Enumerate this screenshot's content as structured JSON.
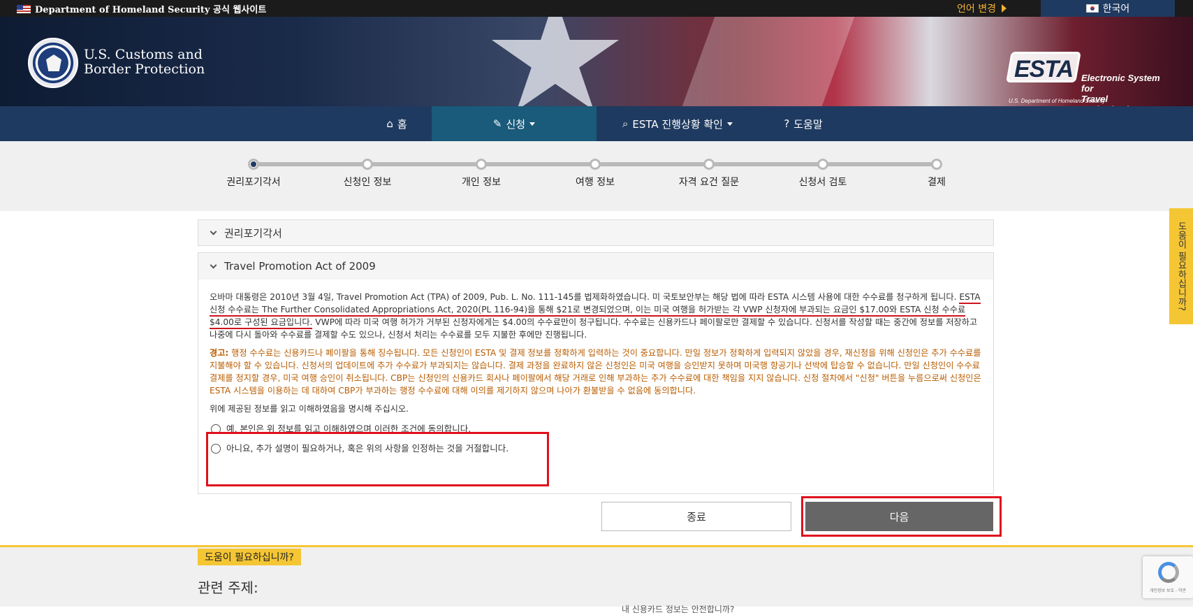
{
  "topbar": {
    "gov_text": "Department of Homeland Security 공식 웹사이트",
    "language_change": "언어 변경",
    "current_language": "한국어"
  },
  "header": {
    "agency_line1": "U.S. Customs and",
    "agency_line2": "Border Protection",
    "esta_word": "ESTA",
    "esta_tag1": "Electronic System for",
    "esta_tag2": "Travel Authorization",
    "esta_sub": "U.S. Department of Homeland Security"
  },
  "nav": {
    "home": "홈",
    "apply": "신청",
    "status": "ESTA 진행상황 확인",
    "help": "도움말"
  },
  "progress": {
    "steps": [
      "권리포기각서",
      "신청인 정보",
      "개인 정보",
      "여행 정보",
      "자격 요건 질문",
      "신청서 검토",
      "결제"
    ],
    "current_index": 0
  },
  "panels": {
    "waiver_title": "권리포기각서",
    "tpa_title": "Travel Promotion Act of 2009",
    "para1_a": "오바마 대통령은 2010년 3월 4일, Travel Promotion Act (TPA) of 2009, Pub. L. No. 111-145를 법제화하였습니다. 미 국토보안부는 해당 법에 따라 ESTA 시스템 사용에 대한 수수료를 청구하게 됩니다. ",
    "para1_underlined": "ESTA 신청 수수료는 The Further Consolidated Appropriations Act, 2020(PL 116-94)을 통해 $21로 변경되었으며, 이는 미국 여행을 허가받는 각 VWP 신청자에 부과되는 요금인 $17.00와 ESTA 신청 수수료 $4.00로 구성된 요금입니다.",
    "para1_b": " VWP에 따라 미국 여행 허가가 거부된 신청자에게는 $4.00의 수수료만이 청구됩니다. 수수료는 신용카드나 페이팔로만 결제할 수 있습니다. 신청서를 작성할 때는 중간에 정보를 저장하고 나중에 다시 돌아와 수수료를 결제할 수도 있으나, 신청서 처리는 수수료를 모두 지불한 후에만 진행됩니다.",
    "warning_label": "경고:",
    "warning_text": " 행정 수수료는 신용카드나 페이팔을 통해 징수됩니다. 모든 신청인이 ESTA 및 결제 정보를 정확하게 입력하는 것이 중요합니다. 만일 정보가 정확하게 입력되지 않았을 경우, 재신청을 위해 신청인은 추가 수수료를 지불해야 할 수 있습니다. 신청서의 업데이트에 추가 수수료가 부과되지는 않습니다. 결제 과정을 완료하지 않은 신청인은 미국 여행을 승인받지 못하며 미국행 항공기나 선박에 탑승할 수 없습니다. 만일 신청인이 수수료 결제를 정지할 경우, 미국 여행 승인이 취소됩니다. CBP는 신청인의 신용카드 회사나 페이팔에서 해당 거래로 인해 부과하는 추가 수수료에 대한 책임을 지지 않습니다. 신청 절차에서 \"신청\" 버튼을 누름으로써 신청인은 ESTA 시스템을 이용하는 데 대하여 CBP가 부과하는 행정 수수료에 대해 이의를 제기하지 않으며 나아가 환불받을 수 없음에 동의합니다.",
    "ack_prompt": "위에 제공된 정보를 읽고 이해하였음을 명시해 주십시오.",
    "radio_yes": "예, 본인은 위 정보를 읽고 이해하였으며 이러한 조건에 동의합니다.",
    "radio_no": "아니요, 추가 설명이 필요하거나, 혹은 위의 사항을 인정하는 것을 거절합니다."
  },
  "buttons": {
    "exit": "종료",
    "next": "다음"
  },
  "footer": {
    "need_help": "도움이 필요하십니까?",
    "related_topics": "관련 주제:",
    "link_partial": "내 신용카드 정보는 안전합니까?"
  },
  "side_tab": "도움이 필요하십니까?",
  "recaptcha_text": "개인정보 보호 - 약관",
  "colors": {
    "nav_bg": "#1f3a60",
    "nav_active": "#1a5a7a",
    "warning": "#b85c00",
    "highlight_red": "#e0101c",
    "help_yellow": "#f5c633"
  }
}
